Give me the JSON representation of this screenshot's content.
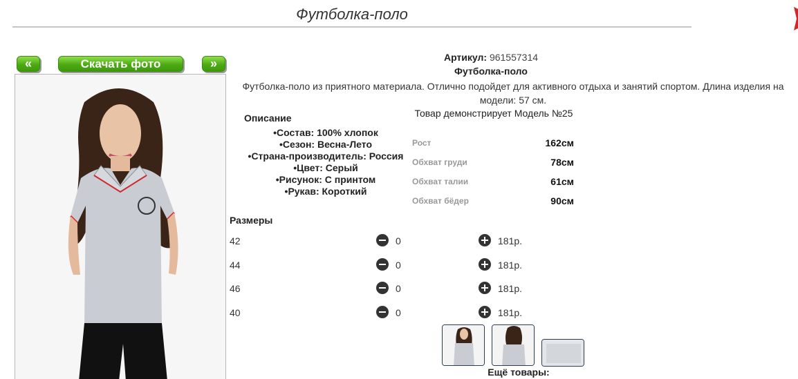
{
  "page": {
    "title": "Футболка-поло"
  },
  "nav": {
    "prev_label": "«",
    "download_label": "Скачать фото",
    "next_label": "»"
  },
  "product": {
    "article_label": "Артикул:",
    "article_value": "961557314",
    "name": "Футболка-поло",
    "description": "Футболка-поло из приятного материала. Отлично подойдет для активного отдыха и занятий спортом. Длина изделия на модели: 57 см.",
    "model_note": "Товар демонстрирует Модель №25"
  },
  "attributes": {
    "heading": "Описание",
    "items": [
      "Состав: 100% хлопок",
      "Сезон: Весна-Лето",
      "Страна-производитель: Россия",
      "Цвет: Серый",
      "Рисунок: С принтом",
      "Рукав: Короткий"
    ]
  },
  "measurements": [
    {
      "label": "Рост",
      "value": "162см"
    },
    {
      "label": "Обхват груди",
      "value": "78см"
    },
    {
      "label": "Обхват талии",
      "value": "61см"
    },
    {
      "label": "Обхват бёдер",
      "value": "90см"
    }
  ],
  "sizes": {
    "heading": "Размеры",
    "rows": [
      {
        "size": "42",
        "qty": "0",
        "price": "181р."
      },
      {
        "size": "44",
        "qty": "0",
        "price": "181р."
      },
      {
        "size": "46",
        "qty": "0",
        "price": "181р."
      },
      {
        "size": "40",
        "qty": "0",
        "price": "181р."
      }
    ]
  },
  "more": {
    "heading": "Ещё товары:"
  },
  "colors": {
    "button_green": "#4caa14",
    "shirt_gray": "#c9cdd3",
    "accent_red": "#d0282a"
  }
}
